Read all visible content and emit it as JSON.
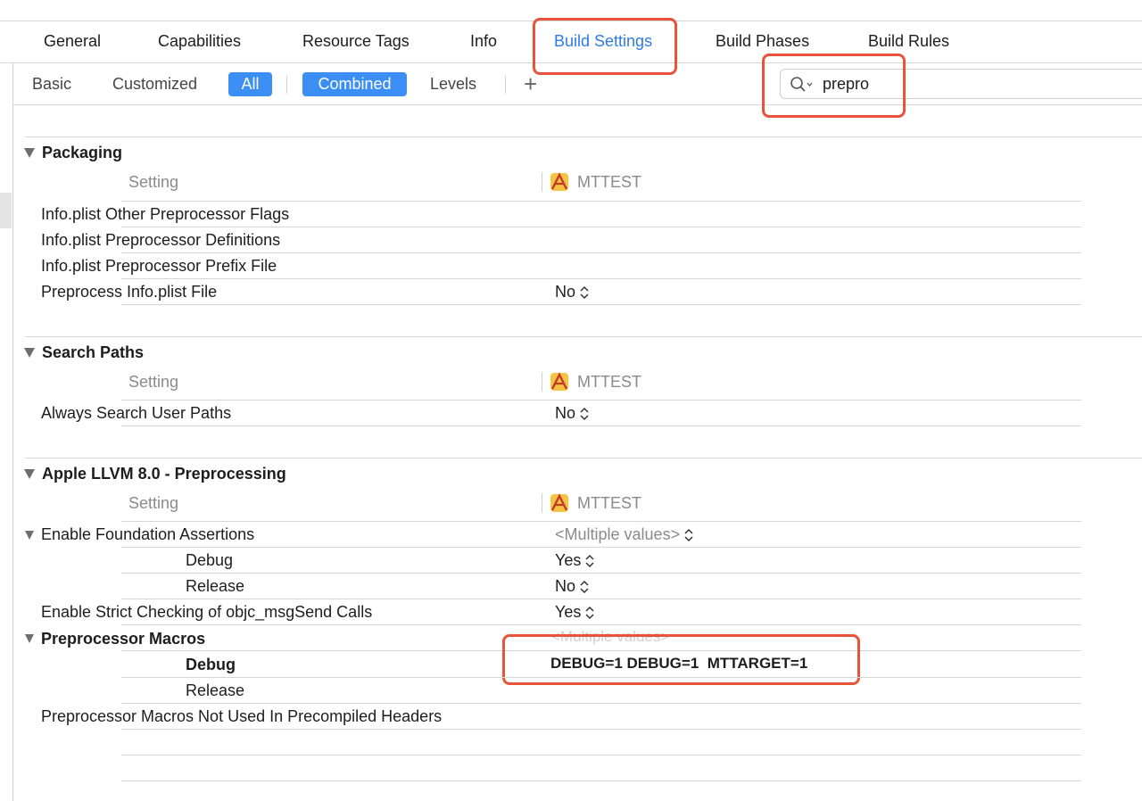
{
  "tabs": [
    {
      "label": "General"
    },
    {
      "label": "Capabilities"
    },
    {
      "label": "Resource Tags"
    },
    {
      "label": "Info"
    },
    {
      "label": "Build Settings",
      "active": true
    },
    {
      "label": "Build Phases"
    },
    {
      "label": "Build Rules"
    }
  ],
  "filters": {
    "basic": "Basic",
    "customized": "Customized",
    "all": "All",
    "combined": "Combined",
    "levels": "Levels",
    "add": "+"
  },
  "search": {
    "value": "prepro",
    "icon": "search-icon"
  },
  "column_header": {
    "setting": "Setting",
    "target": "MTTEST"
  },
  "sections": {
    "packaging": {
      "title": "Packaging",
      "rows": [
        {
          "label": "Info.plist Other Preprocessor Flags",
          "value": ""
        },
        {
          "label": "Info.plist Preprocessor Definitions",
          "value": ""
        },
        {
          "label": "Info.plist Preprocessor Prefix File",
          "value": ""
        },
        {
          "label": "Preprocess Info.plist File",
          "value": "No"
        }
      ]
    },
    "search_paths": {
      "title": "Search Paths",
      "rows": [
        {
          "label": "Always Search User Paths",
          "value": "No"
        }
      ]
    },
    "llvm": {
      "title": "Apple LLVM 8.0 - Preprocessing",
      "rows": [
        {
          "label": "Enable Foundation Assertions",
          "value": "<Multiple values>"
        },
        {
          "label": "Debug",
          "value": "Yes"
        },
        {
          "label": "Release",
          "value": "No"
        },
        {
          "label": "Enable Strict Checking of objc_msgSend Calls",
          "value": "Yes"
        },
        {
          "label": "Preprocessor Macros",
          "value": "<Multiple values>"
        },
        {
          "label": "Debug",
          "value": "DEBUG=1 DEBUG=1  MTTARGET=1"
        },
        {
          "label": "Release",
          "value": ""
        },
        {
          "label": "Preprocessor Macros Not Used In Precompiled Headers",
          "value": ""
        }
      ]
    }
  },
  "colors": {
    "accent": "#3b8ef3",
    "active_tab": "#2d7be5",
    "highlight": "#e8543a"
  }
}
